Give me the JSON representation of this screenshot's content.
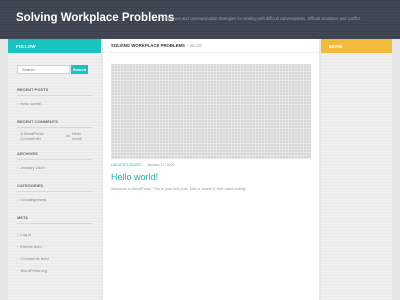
{
  "header": {
    "title": "Solving Workplace Problems",
    "description": "Techniques and communication strategies for dealing with difficult conversations, difficult situations and conflict"
  },
  "left_sidebar": {
    "panel_title": "Follow",
    "search": {
      "placeholder": "Search",
      "button_label": "Search"
    },
    "recent_posts": {
      "title": "Recent Posts",
      "items": [
        "Hello world!"
      ]
    },
    "recent_comments": {
      "title": "Recent Comments",
      "author": "A WordPress Commenter",
      "connector": "on",
      "post": "Hello world!"
    },
    "archives": {
      "title": "Archives",
      "items": [
        "January 2020"
      ]
    },
    "categories": {
      "title": "Categories",
      "items": [
        "Uncategorized"
      ]
    },
    "meta": {
      "title": "Meta",
      "items": [
        "Log in",
        "Entries feed",
        "Comments feed",
        "WordPress.org"
      ]
    }
  },
  "breadcrumb": {
    "site": "Solving Workplace Problems",
    "separator": "/",
    "current": "Blog"
  },
  "post": {
    "category": "Uncategorized",
    "date": "January 17, 2020",
    "title": "Hello world!",
    "excerpt": "Welcome to WordPress. This is your first post. Edit or delete it, then start writing!"
  },
  "right_sidebar": {
    "panel_title": "More"
  },
  "colors": {
    "header_bg": "#3d4450",
    "accent_teal": "#18c3bd",
    "accent_yellow": "#f2bb3b"
  }
}
